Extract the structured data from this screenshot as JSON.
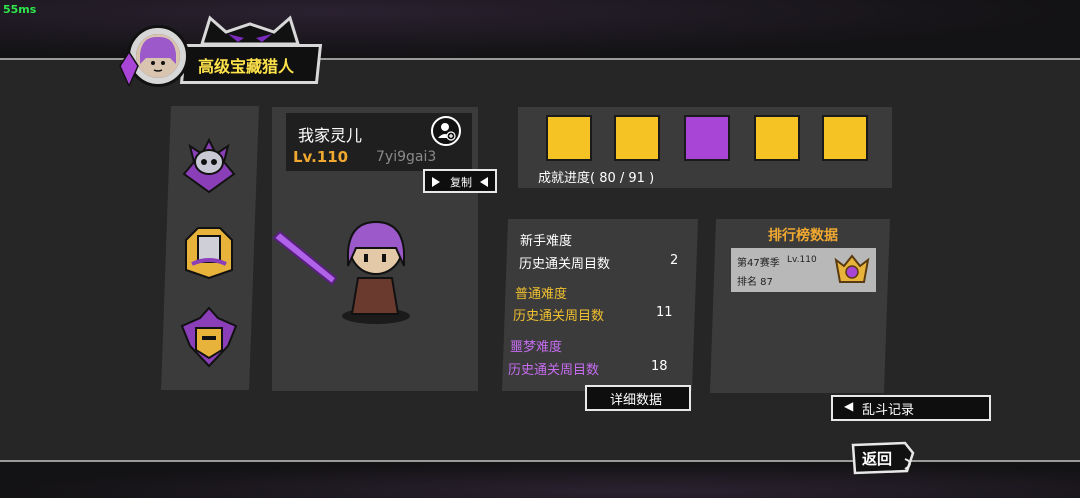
{
  "fps": "55ms",
  "player": {
    "title": "高级宝藏猎人",
    "name": "我家灵儿",
    "level": "Lv.110",
    "uid": "7yi9gai3",
    "copy_label": "复制"
  },
  "achievements": {
    "progress_label": "成就进度( 80 / 91 )",
    "icons": [
      "trophy-icon",
      "hammer-icon",
      "level-110-shield-icon",
      "chest-icon",
      "treasure-pile-icon"
    ]
  },
  "stats": {
    "novice": {
      "label": "新手难度",
      "row_label": "历史通关周目数",
      "value": "2"
    },
    "normal": {
      "label": "普通难度",
      "row_label": "历史通关周目数",
      "value": "11"
    },
    "nightmare": {
      "label": "噩梦难度",
      "row_label": "历史通关周目数",
      "value": "18"
    },
    "detail_button": "详细数据"
  },
  "ranking": {
    "title": "排行榜数据",
    "season": "第47赛季",
    "level": "Lv.110",
    "rank": "排名 87"
  },
  "buttons": {
    "brawl_record": "乱斗记录",
    "back": "返回"
  },
  "colors": {
    "gold": "#f0a830",
    "yellow_title": "#ffe34a",
    "purple": "#c66cf0",
    "fps_green": "#2ee84b"
  }
}
